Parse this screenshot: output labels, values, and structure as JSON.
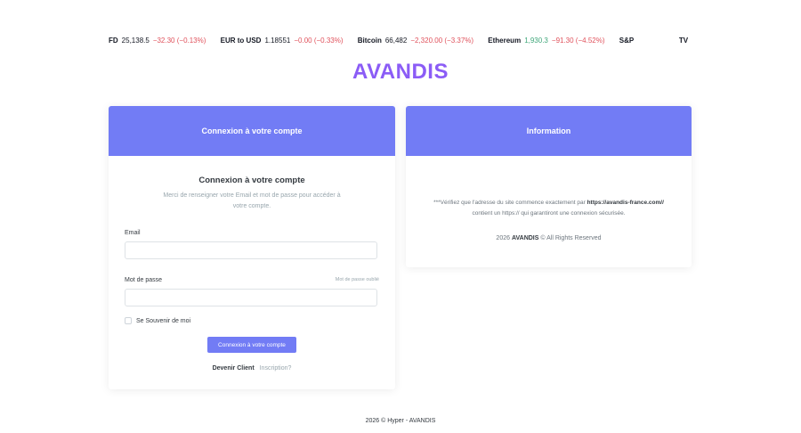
{
  "ticker": [
    {
      "symbol": "FD",
      "price": "25,138.5",
      "change": "−32.30 (−0.13%)",
      "direction": "down"
    },
    {
      "symbol": "EUR to USD",
      "price": "1.18551",
      "change": "−0.00 (−0.33%)",
      "direction": "down"
    },
    {
      "symbol": "Bitcoin",
      "price": "66,482",
      "change": "−2,320.00 (−3.37%)",
      "direction": "down"
    },
    {
      "symbol": "Ethereum",
      "price": "1,930.3",
      "change": "−91.30 (−4.52%)",
      "direction": "up"
    },
    {
      "symbol": "S&P",
      "price": "",
      "change": "",
      "direction": "down"
    }
  ],
  "ticker_logo": "TV",
  "brand": "AVANDIS",
  "login": {
    "header": "Connexion à votre compte",
    "title": "Connexion à votre compte",
    "subtitle": "Merci de renseigner votre Email et mot de passe pour accéder à votre compte.",
    "email_label": "Email",
    "email_value": "",
    "password_label": "Mot de passe",
    "password_value": "",
    "forgot_label": "Mot de passe oublié",
    "remember_label": "Se Souvenir de moi",
    "submit_label": "Connexion à votre compte",
    "signup_label": "Devenir Client",
    "signup_link": "Inscription?"
  },
  "info": {
    "header": "Information",
    "notice_prefix": "***Vérifiez que l'adresse du site commence exactement par ",
    "notice_url": "https://avandis-france.com//",
    "notice_suffix": " contient un https:// qui garantiront une connexion sécurisée.",
    "copy_year": "2026",
    "copy_brand": "AVANDIS",
    "copy_suffix": "© All Rights Reserved"
  },
  "footer": "2026 © Hyper - AVANDIS",
  "colors": {
    "accent": "#727cf5",
    "brand": "#8b5cf6",
    "down": "#e0525c",
    "up": "#3fa77a"
  }
}
